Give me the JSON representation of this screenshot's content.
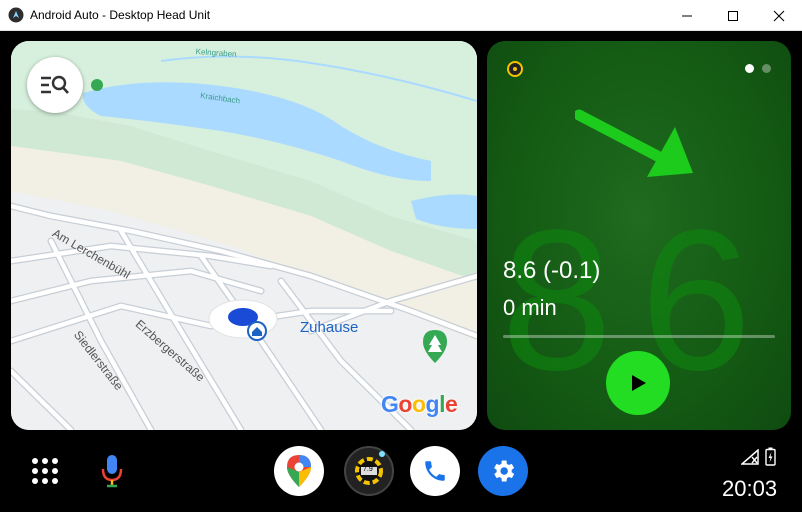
{
  "window": {
    "title": "Android Auto - Desktop Head Unit",
    "controls": [
      "minimize",
      "maximize",
      "close"
    ]
  },
  "map": {
    "search_icon": "search-menu-icon",
    "poi_label": "Zuhause",
    "streets": [
      "Am Lerchenbühl",
      "Erzbergerstraße",
      "Siedlerstraße"
    ],
    "water_labels": [
      "Kelngraben",
      "Kraichbach"
    ],
    "logo": "Google",
    "colors": {
      "water": "#aadaff",
      "park": "#c8ecd2",
      "road": "#ffffff",
      "road_edge": "#b9c2cc",
      "poi": "#1d63c4"
    }
  },
  "nav_card": {
    "value_text": "8.6 (-0.1)",
    "eta_text": "0 min",
    "big_digits": "86",
    "page_dots": 2,
    "active_dot": 1,
    "progress": 0.0,
    "colors": {
      "background": "#145a14",
      "play": "#22dd22"
    }
  },
  "dock": {
    "apps": [
      {
        "name": "launcher",
        "icon": "app-grid-icon"
      },
      {
        "name": "assistant",
        "icon": "microphone-icon"
      },
      {
        "name": "maps",
        "icon": "google-maps-icon"
      },
      {
        "name": "gauge",
        "icon": "gauge-app-icon",
        "badge": "7.9"
      },
      {
        "name": "phone",
        "icon": "phone-icon"
      },
      {
        "name": "settings",
        "icon": "gear-icon"
      }
    ],
    "clock": "20:03",
    "status_icons": [
      "no-signal-icon",
      "battery-charging-icon"
    ]
  }
}
